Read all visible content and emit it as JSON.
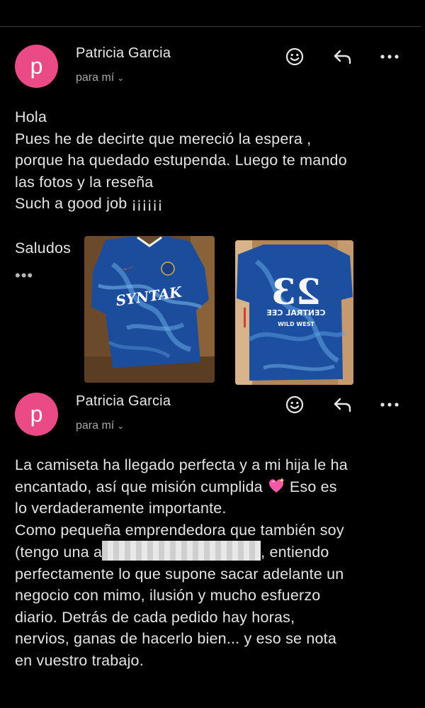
{
  "emails": [
    {
      "avatar_letter": "p",
      "sender": "Patricia Garcia",
      "recipient": "para mí",
      "body_lines": [
        "Hola",
        "Pues he de decirte que mereció la espera ,",
        "porque ha quedado estupenda. Luego te mando",
        "las fotos y la reseña",
        "Such a good job ¡¡¡¡¡¡"
      ],
      "signoff": "Saludos",
      "more_dots": "•••"
    },
    {
      "avatar_letter": "p",
      "sender": "Patricia Garcia",
      "recipient": "para mí",
      "body": {
        "l1": "La camiseta ha llegado perfecta y a mi hija le ha",
        "l2a": "encantado, así que misión cumplida",
        "l2b": "Eso es",
        "l3": "lo verdaderamente importante.",
        "l4": "Como pequeña emprendedora que también soy",
        "l5a": "(tengo una a",
        "l5b": ", entiendo",
        "l6": "perfectamente lo que supone sacar adelante un",
        "l7": "negocio con mimo, ilusión y mucho esfuerzo",
        "l8": "diario. Detrás de cada pedido hay horas,",
        "l9": "nervios, ganas de hacerlo bien... y eso se nota",
        "l10": "en vuestro trabajo."
      }
    }
  ],
  "jersey_back": {
    "number": "23",
    "name": "CENTRAL CEE",
    "sub": "WILD WEST"
  },
  "colors": {
    "background": "#000000",
    "avatar": "#ea4a86",
    "text": "#e4e4e4",
    "secondary": "#a9a9a9",
    "jersey": "#1d4fa0"
  }
}
